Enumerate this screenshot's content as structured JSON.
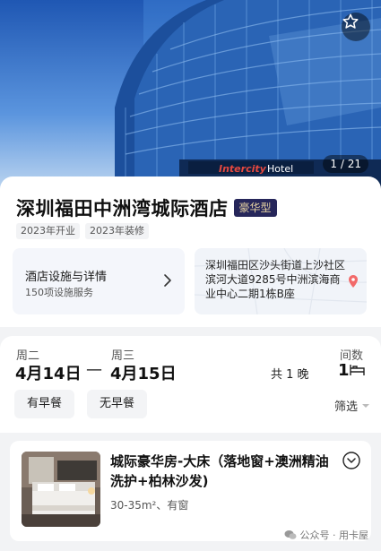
{
  "hero": {
    "photo_counter": "1 / 21",
    "favorite_icon": "star-outline-icon",
    "sign_text": "Intercity Hotel"
  },
  "hotel": {
    "name": "深圳福田中洲湾城际酒店",
    "grade": "豪华型",
    "tags": [
      "2023年开业",
      "2023年装修"
    ],
    "facilities_title": "酒店设施与详情",
    "facilities_sub": "150项设施服务",
    "address": "深圳福田区沙头街道上沙社区滨河大道9285号中洲滨海商业中心二期1栋B座"
  },
  "booking": {
    "checkin_weekday": "周二",
    "checkin_date": "4月14日",
    "separator": "—",
    "checkout_weekday": "周三",
    "checkout_date": "4月15日",
    "nights": "共 1 晚",
    "rooms_label": "间数",
    "rooms_count": "1",
    "filters": [
      "有早餐",
      "无早餐"
    ],
    "filter_select": "筛选"
  },
  "room": {
    "name": "城际豪华房-大床（落地窗+澳洲精油洗护+柏林沙发)",
    "spec": "30-35m²、有窗"
  },
  "watermark": "公众号 · 用卡屋",
  "colors": {
    "grade_badge_bg": "#26265a",
    "grade_badge_text": "#e6d3a3",
    "map_pin": "#f26a6a"
  }
}
